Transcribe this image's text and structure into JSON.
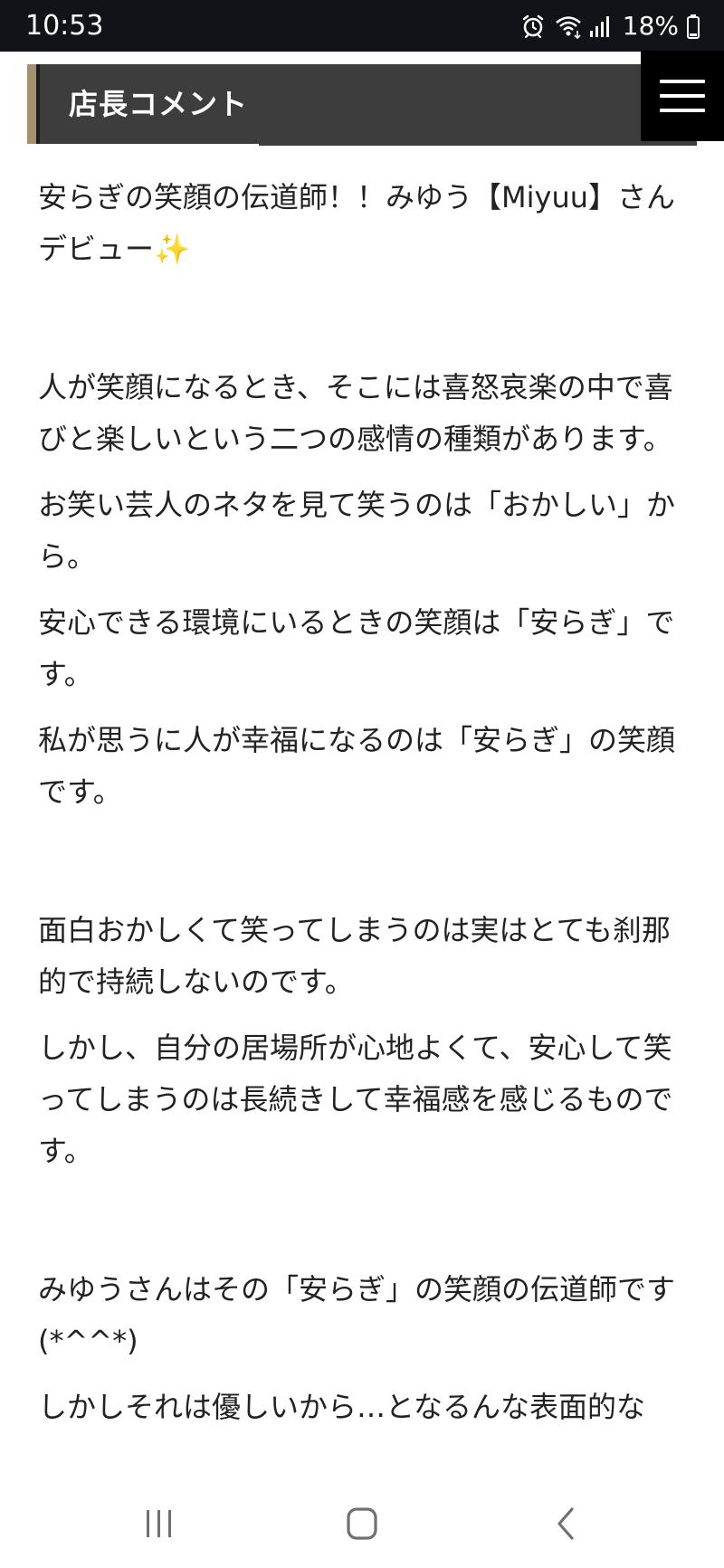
{
  "status_bar": {
    "time": "10:53",
    "battery": "18%",
    "icons": [
      "alarm-icon",
      "wifi-icon",
      "signal-icon",
      "battery-icon"
    ]
  },
  "header": {
    "title": "店長コメント",
    "menu_icon": "hamburger-menu-icon",
    "accent_color": "#a5916d",
    "bar_color": "#3d3d3d"
  },
  "content": {
    "paragraphs": [
      "安らぎの笑顔の伝道師！！みゆう【Miyuu】さんデビュー",
      "人が笑顔になるとき、そこには喜怒哀楽の中で喜びと楽しいという二つの感情の種類があります。",
      "お笑い芸人のネタを見て笑うのは「おかしい」から。",
      "安心できる環境にいるときの笑顔は「安らぎ」です。",
      "私が思うに人が幸福になるのは「安らぎ」の笑顔です。",
      "面白おかしくて笑ってしまうのは実はとても刹那的で持続しないのです。",
      "しかし、自分の居場所が心地よくて、安心して笑ってしまうのは長続きして幸福感を感じるものです。",
      "みゆうさんはその「安らぎ」の笑顔の伝道師です(*^^*)",
      "しかしそれは優しいから…となるんな表面的な"
    ],
    "sparkle_emoji": "✨"
  },
  "nav_bar": {
    "icons": [
      "recent-apps-icon",
      "home-icon",
      "back-icon"
    ]
  }
}
